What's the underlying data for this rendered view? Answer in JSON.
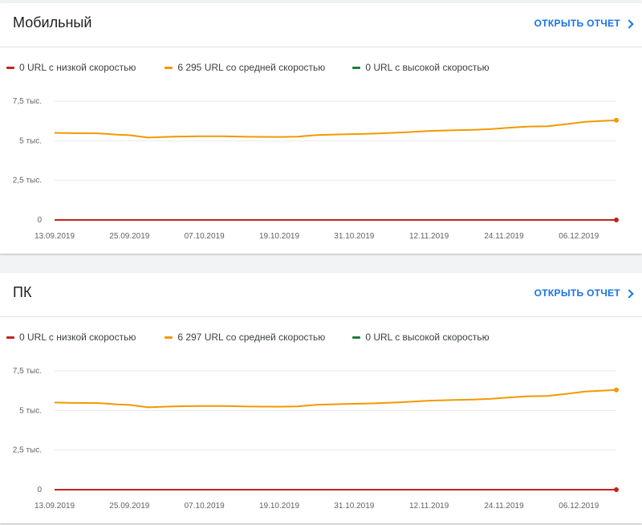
{
  "panels": [
    {
      "title": "Мобильный",
      "open_report": "ОТКРЫТЬ ОТЧЕТ",
      "legend": [
        {
          "label": "0 URL с низкой скоростью",
          "color": "#c5221f"
        },
        {
          "label": "6 295 URL со средней скоростью",
          "color": "#f29900"
        },
        {
          "label": "0 URL с высокой скоростью",
          "color": "#188038"
        }
      ]
    },
    {
      "title": "ПК",
      "open_report": "ОТКРЫТЬ ОТЧЕТ",
      "legend": [
        {
          "label": "0 URL с низкой скоростью",
          "color": "#c5221f"
        },
        {
          "label": "6 297 URL со средней скоростью",
          "color": "#f29900"
        },
        {
          "label": "0 URL с высокой скоростью",
          "color": "#188038"
        }
      ]
    }
  ],
  "chart_data": [
    {
      "type": "line",
      "x_start": "13.09.2019",
      "x_end": "12.12.2019",
      "x_tick_labels": [
        "13.09.2019",
        "25.09.2019",
        "07.10.2019",
        "19.10.2019",
        "31.10.2019",
        "12.11.2019",
        "24.11.2019",
        "06.12.2019"
      ],
      "y_tick_values": [
        0,
        2500,
        5000,
        7500
      ],
      "y_tick_labels": [
        "0",
        "2,5 тыс.",
        "5 тыс.",
        "7,5 тыс."
      ],
      "ylim": [
        0,
        7500
      ],
      "grid": true,
      "series": [
        {
          "name": "0 URL с низкой скоростью",
          "color": "#c5221f",
          "x": [
            "13.09.2019",
            "12.12.2019"
          ],
          "y": [
            0,
            0
          ]
        },
        {
          "name": "6 295 URL со средней скоростью",
          "color": "#f29900",
          "x": [
            "13.09.2019",
            "16.09.2019",
            "20.09.2019",
            "23.09.2019",
            "25.09.2019",
            "28.09.2019",
            "02.10.2019",
            "06.10.2019",
            "10.10.2019",
            "14.10.2019",
            "19.10.2019",
            "22.10.2019",
            "25.10.2019",
            "29.10.2019",
            "03.11.2019",
            "08.11.2019",
            "12.11.2019",
            "16.11.2019",
            "19.11.2019",
            "22.11.2019",
            "25.11.2019",
            "28.11.2019",
            "01.12.2019",
            "04.12.2019",
            "07.12.2019",
            "12.12.2019"
          ],
          "y": [
            5500,
            5480,
            5470,
            5380,
            5350,
            5200,
            5260,
            5280,
            5280,
            5250,
            5240,
            5260,
            5360,
            5400,
            5450,
            5530,
            5620,
            5660,
            5690,
            5740,
            5830,
            5900,
            5920,
            6050,
            6200,
            6295
          ]
        },
        {
          "name": "0 URL с высокой скоростью",
          "color": "#188038",
          "x": [
            "13.09.2019",
            "12.12.2019"
          ],
          "y": [
            0,
            0
          ]
        }
      ]
    },
    {
      "type": "line",
      "x_start": "13.09.2019",
      "x_end": "12.12.2019",
      "x_tick_labels": [
        "13.09.2019",
        "25.09.2019",
        "07.10.2019",
        "19.10.2019",
        "31.10.2019",
        "12.11.2019",
        "24.11.2019",
        "06.12.2019"
      ],
      "y_tick_values": [
        0,
        2500,
        5000,
        7500
      ],
      "y_tick_labels": [
        "0",
        "2,5 тыс.",
        "5 тыс.",
        "7,5 тыс."
      ],
      "ylim": [
        0,
        7500
      ],
      "grid": true,
      "series": [
        {
          "name": "0 URL с низкой скоростью",
          "color": "#c5221f",
          "x": [
            "13.09.2019",
            "12.12.2019"
          ],
          "y": [
            0,
            0
          ]
        },
        {
          "name": "6 297 URL со средней скоростью",
          "color": "#f29900",
          "x": [
            "13.09.2019",
            "16.09.2019",
            "20.09.2019",
            "23.09.2019",
            "25.09.2019",
            "28.09.2019",
            "02.10.2019",
            "06.10.2019",
            "10.10.2019",
            "14.10.2019",
            "19.10.2019",
            "22.10.2019",
            "25.10.2019",
            "29.10.2019",
            "03.11.2019",
            "08.11.2019",
            "12.11.2019",
            "16.11.2019",
            "19.11.2019",
            "22.11.2019",
            "25.11.2019",
            "28.11.2019",
            "01.12.2019",
            "04.12.2019",
            "07.12.2019",
            "12.12.2019"
          ],
          "y": [
            5500,
            5480,
            5470,
            5380,
            5350,
            5200,
            5260,
            5280,
            5280,
            5250,
            5240,
            5260,
            5360,
            5400,
            5450,
            5530,
            5620,
            5660,
            5690,
            5740,
            5830,
            5900,
            5920,
            6050,
            6200,
            6297
          ]
        },
        {
          "name": "0 URL с высокой скоростью",
          "color": "#188038",
          "x": [
            "13.09.2019",
            "12.12.2019"
          ],
          "y": [
            0,
            0
          ]
        }
      ]
    }
  ]
}
